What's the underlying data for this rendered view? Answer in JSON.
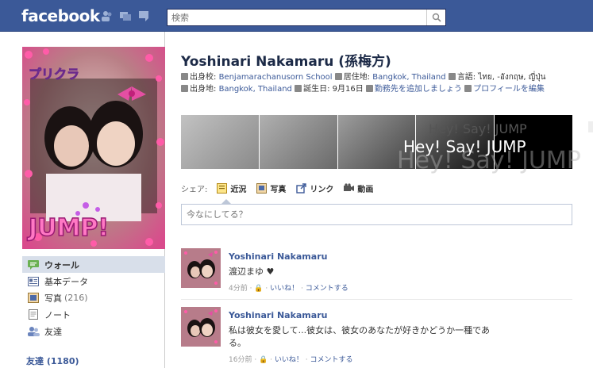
{
  "topbar": {
    "logo": "facebook",
    "search_placeholder": "検索"
  },
  "profile": {
    "name": "Yoshinari Nakamaru (孫梅方)",
    "info": {
      "school_label": "出身校:",
      "school": "Benjamarachanusorn School",
      "residence_label": "居住地:",
      "residence": "Bangkok, Thailand",
      "language_label": "言語:",
      "language": "ไทย, -อังกฤษ, ญี่ปุ่น",
      "hometown_label": "出身地:",
      "hometown": "Bangkok, Thailand",
      "birthday_label": "誕生日:",
      "birthday": "9月16日",
      "add_work": "勤務先を追加しましょう",
      "edit_profile": "プロフィールを編集"
    },
    "banner_text": "Hey! Say! JUMP"
  },
  "leftnav": {
    "items": [
      {
        "label": "ウォール",
        "count": ""
      },
      {
        "label": "基本データ",
        "count": ""
      },
      {
        "label": "写真",
        "count": "(216)"
      },
      {
        "label": "ノート",
        "count": ""
      },
      {
        "label": "友達",
        "count": ""
      }
    ],
    "friends_label": "友達",
    "friends_count": "(1180)"
  },
  "composer": {
    "share_label": "シェア:",
    "tabs": [
      "近況",
      "写真",
      "リンク",
      "動画"
    ],
    "placeholder": "今なにしてる？"
  },
  "posts": [
    {
      "author": "Yoshinari Nakamaru",
      "text": "渡辺まゆ ♥",
      "time": "4分前",
      "like": "いいね！",
      "comment": "コメントする"
    },
    {
      "author": "Yoshinari Nakamaru",
      "text": "私は彼女を愛して...彼女は、彼女のあなたが好きかどうか一種である。",
      "time": "16分前",
      "like": "いいね！",
      "comment": "コメントする"
    }
  ]
}
